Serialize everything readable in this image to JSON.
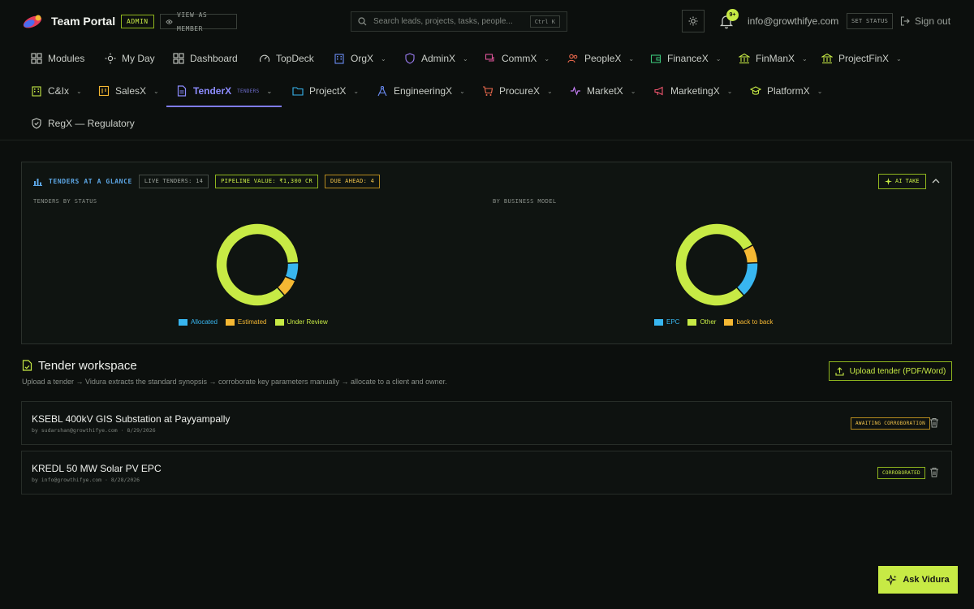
{
  "header": {
    "brand": "Team Portal",
    "role_badge": "ADMIN",
    "view_as_member": "VIEW AS MEMBER",
    "search_placeholder": "Search leads, projects, tasks, people...",
    "search_shortcut": "Ctrl K",
    "notifications_count": "9+",
    "user_email": "info@growthifye.com",
    "set_status": "SET STATUS",
    "sign_out": "Sign out"
  },
  "nav": {
    "row1": [
      {
        "label": "Modules",
        "icon": "grid-icon"
      },
      {
        "label": "My Day",
        "icon": "sun-icon"
      },
      {
        "label": "Dashboard",
        "icon": "grid-icon"
      },
      {
        "label": "TopDeck",
        "icon": "gauge-icon"
      },
      {
        "label": "OrgX",
        "icon": "building-icon"
      },
      {
        "label": "AdminX",
        "icon": "shield-icon"
      },
      {
        "label": "CommX",
        "icon": "chat-icon"
      },
      {
        "label": "PeopleX",
        "icon": "people-icon"
      },
      {
        "label": "FinanceX",
        "icon": "wallet-icon"
      },
      {
        "label": "FinManX",
        "icon": "bank-icon"
      },
      {
        "label": "ProjectFinX",
        "icon": "bank-icon"
      }
    ],
    "row2": [
      {
        "label": "C&Ix",
        "icon": "building-icon"
      },
      {
        "label": "SalesX",
        "icon": "board-icon"
      },
      {
        "label": "TenderX",
        "icon": "document-icon",
        "sub": "TENDERS"
      },
      {
        "label": "ProjectX",
        "icon": "folder-icon"
      },
      {
        "label": "EngineeringX",
        "icon": "compass-icon"
      },
      {
        "label": "ProcureX",
        "icon": "cart-icon"
      },
      {
        "label": "MarketX",
        "icon": "pulse-icon"
      },
      {
        "label": "MarketingX",
        "icon": "megaphone-icon"
      },
      {
        "label": "PlatformX",
        "icon": "graduation-icon"
      }
    ],
    "row3": [
      {
        "label": "RegX — Regulatory",
        "icon": "shield-icon"
      }
    ]
  },
  "glance": {
    "title": "TENDERS AT A GLANCE",
    "live_tenders": "LIVE TENDERS: 14",
    "pipeline_value": "PIPELINE VALUE: ₹1,300 CR",
    "due_ahead": "DUE AHEAD: 4",
    "ai_take": "AI TAKE",
    "left_label": "TENDERS BY STATUS",
    "right_label": "BY BUSINESS MODEL",
    "colors": {
      "blue": "#38b6f0",
      "amber": "#f5b833",
      "lime": "#c7ea45"
    }
  },
  "chart_data": [
    {
      "type": "pie",
      "title": "TENDERS BY STATUS",
      "categories": [
        "Allocated",
        "Estimated",
        "Under Review"
      ],
      "values": [
        1,
        1,
        12
      ],
      "colors": [
        "#38b6f0",
        "#f5b833",
        "#c7ea45"
      ]
    },
    {
      "type": "pie",
      "title": "BY BUSINESS MODEL",
      "categories": [
        "EPC",
        "Other",
        "back to back"
      ],
      "values": [
        2,
        11,
        1
      ],
      "colors": [
        "#38b6f0",
        "#c7ea45",
        "#f5b833"
      ]
    }
  ],
  "workspace": {
    "title": "Tender workspace",
    "description": "Upload a tender → Vidura extracts the standard synopsis → corroborate key parameters manually → allocate to a client and owner.",
    "upload_button": "Upload tender (PDF/Word)",
    "tenders": [
      {
        "title": "KSEBL 400kV GIS Substation at Payyampally",
        "meta": "by sudarshan@growthifye.com · 8/29/2026",
        "status": "AWAITING CORROBORATION"
      },
      {
        "title": "KREDL 50 MW Solar PV EPC",
        "meta": "by info@growthifye.com · 8/28/2026",
        "status": "CORROBORATED"
      }
    ]
  },
  "assistant": {
    "button": "Ask Vidura"
  }
}
